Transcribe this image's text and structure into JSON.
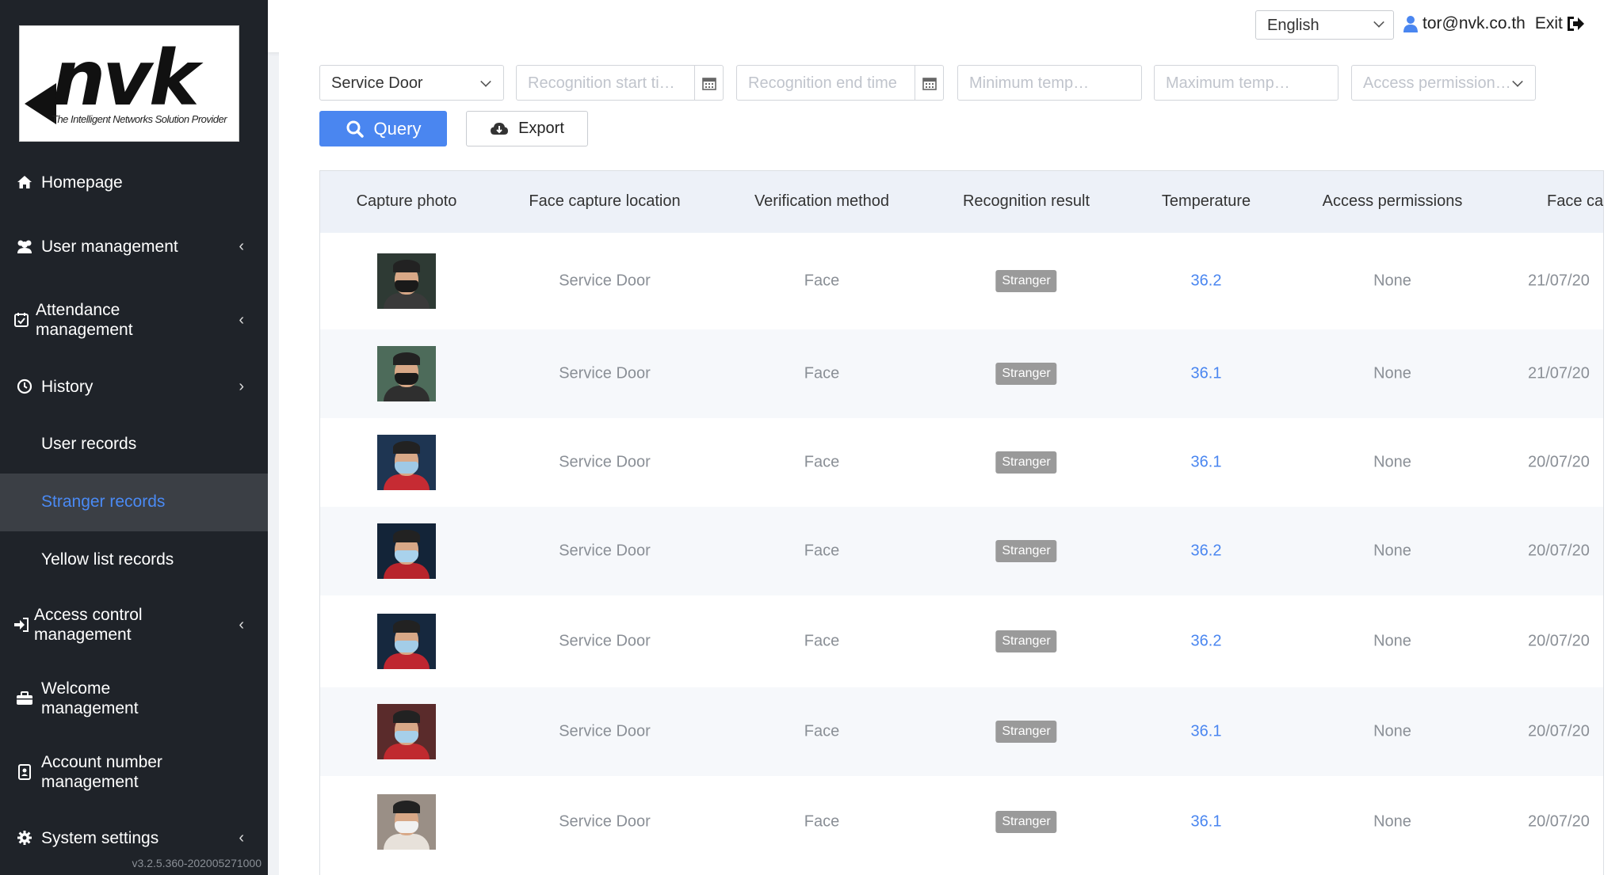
{
  "brand": {
    "logo_text": "nvk",
    "tagline": "The Intelligent Networks Solution Provider"
  },
  "sidebar": {
    "items": [
      {
        "label": "Homepage",
        "icon": "home-icon"
      },
      {
        "label": "User management",
        "icon": "users-icon"
      },
      {
        "label": "Attendance management",
        "icon": "calendar-check-icon"
      },
      {
        "label": "History",
        "icon": "clock-icon"
      },
      {
        "label": "User records"
      },
      {
        "label": "Stranger records"
      },
      {
        "label": "Yellow list records"
      },
      {
        "label": "Access control management",
        "icon": "sign-in-icon"
      },
      {
        "label": "Welcome management",
        "icon": "briefcase-icon"
      },
      {
        "label": "Account number management",
        "icon": "id-card-icon"
      },
      {
        "label": "System settings",
        "icon": "gear-icon"
      }
    ],
    "version": "v3.2.5.360-202005271000"
  },
  "header": {
    "language": "English",
    "user_email": "tor@nvk.co.th",
    "exit_label": "Exit"
  },
  "filters": {
    "location": "Service Door",
    "start_placeholder": "Recognition start ti…",
    "end_placeholder": "Recognition end time",
    "min_temp_placeholder": "Minimum temp…",
    "max_temp_placeholder": "Maximum temp…",
    "access_placeholder": "Access permission…"
  },
  "actions": {
    "query_label": "Query",
    "export_label": "Export"
  },
  "table": {
    "columns": [
      "Capture photo",
      "Face capture location",
      "Verification method",
      "Recognition result",
      "Temperature",
      "Access permissions",
      "Face ca"
    ],
    "rows": [
      {
        "location": "Service Door",
        "method": "Face",
        "result": "Stranger",
        "temperature": "36.2",
        "access": "None",
        "time": "21/07/20"
      },
      {
        "location": "Service Door",
        "method": "Face",
        "result": "Stranger",
        "temperature": "36.1",
        "access": "None",
        "time": "21/07/20"
      },
      {
        "location": "Service Door",
        "method": "Face",
        "result": "Stranger",
        "temperature": "36.1",
        "access": "None",
        "time": "20/07/20"
      },
      {
        "location": "Service Door",
        "method": "Face",
        "result": "Stranger",
        "temperature": "36.2",
        "access": "None",
        "time": "20/07/20"
      },
      {
        "location": "Service Door",
        "method": "Face",
        "result": "Stranger",
        "temperature": "36.2",
        "access": "None",
        "time": "20/07/20"
      },
      {
        "location": "Service Door",
        "method": "Face",
        "result": "Stranger",
        "temperature": "36.1",
        "access": "None",
        "time": "20/07/20"
      },
      {
        "location": "Service Door",
        "method": "Face",
        "result": "Stranger",
        "temperature": "36.1",
        "access": "None",
        "time": "20/07/20"
      }
    ]
  },
  "colors": {
    "accent": "#4a86f0",
    "sidebar_bg": "#1f2329",
    "active_bg": "#3b3f45",
    "badge_bg": "#9a9a9a"
  }
}
